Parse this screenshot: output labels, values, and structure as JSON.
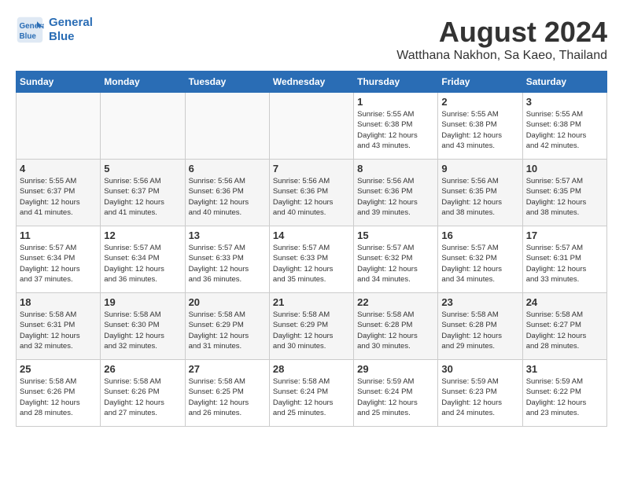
{
  "logo": {
    "line1": "General",
    "line2": "Blue"
  },
  "title": "August 2024",
  "location": "Watthana Nakhon, Sa Kaeo, Thailand",
  "weekdays": [
    "Sunday",
    "Monday",
    "Tuesday",
    "Wednesday",
    "Thursday",
    "Friday",
    "Saturday"
  ],
  "weeks": [
    [
      {
        "day": "",
        "info": ""
      },
      {
        "day": "",
        "info": ""
      },
      {
        "day": "",
        "info": ""
      },
      {
        "day": "",
        "info": ""
      },
      {
        "day": "1",
        "info": "Sunrise: 5:55 AM\nSunset: 6:38 PM\nDaylight: 12 hours\nand 43 minutes."
      },
      {
        "day": "2",
        "info": "Sunrise: 5:55 AM\nSunset: 6:38 PM\nDaylight: 12 hours\nand 43 minutes."
      },
      {
        "day": "3",
        "info": "Sunrise: 5:55 AM\nSunset: 6:38 PM\nDaylight: 12 hours\nand 42 minutes."
      }
    ],
    [
      {
        "day": "4",
        "info": "Sunrise: 5:55 AM\nSunset: 6:37 PM\nDaylight: 12 hours\nand 41 minutes."
      },
      {
        "day": "5",
        "info": "Sunrise: 5:56 AM\nSunset: 6:37 PM\nDaylight: 12 hours\nand 41 minutes."
      },
      {
        "day": "6",
        "info": "Sunrise: 5:56 AM\nSunset: 6:36 PM\nDaylight: 12 hours\nand 40 minutes."
      },
      {
        "day": "7",
        "info": "Sunrise: 5:56 AM\nSunset: 6:36 PM\nDaylight: 12 hours\nand 40 minutes."
      },
      {
        "day": "8",
        "info": "Sunrise: 5:56 AM\nSunset: 6:36 PM\nDaylight: 12 hours\nand 39 minutes."
      },
      {
        "day": "9",
        "info": "Sunrise: 5:56 AM\nSunset: 6:35 PM\nDaylight: 12 hours\nand 38 minutes."
      },
      {
        "day": "10",
        "info": "Sunrise: 5:57 AM\nSunset: 6:35 PM\nDaylight: 12 hours\nand 38 minutes."
      }
    ],
    [
      {
        "day": "11",
        "info": "Sunrise: 5:57 AM\nSunset: 6:34 PM\nDaylight: 12 hours\nand 37 minutes."
      },
      {
        "day": "12",
        "info": "Sunrise: 5:57 AM\nSunset: 6:34 PM\nDaylight: 12 hours\nand 36 minutes."
      },
      {
        "day": "13",
        "info": "Sunrise: 5:57 AM\nSunset: 6:33 PM\nDaylight: 12 hours\nand 36 minutes."
      },
      {
        "day": "14",
        "info": "Sunrise: 5:57 AM\nSunset: 6:33 PM\nDaylight: 12 hours\nand 35 minutes."
      },
      {
        "day": "15",
        "info": "Sunrise: 5:57 AM\nSunset: 6:32 PM\nDaylight: 12 hours\nand 34 minutes."
      },
      {
        "day": "16",
        "info": "Sunrise: 5:57 AM\nSunset: 6:32 PM\nDaylight: 12 hours\nand 34 minutes."
      },
      {
        "day": "17",
        "info": "Sunrise: 5:57 AM\nSunset: 6:31 PM\nDaylight: 12 hours\nand 33 minutes."
      }
    ],
    [
      {
        "day": "18",
        "info": "Sunrise: 5:58 AM\nSunset: 6:31 PM\nDaylight: 12 hours\nand 32 minutes."
      },
      {
        "day": "19",
        "info": "Sunrise: 5:58 AM\nSunset: 6:30 PM\nDaylight: 12 hours\nand 32 minutes."
      },
      {
        "day": "20",
        "info": "Sunrise: 5:58 AM\nSunset: 6:29 PM\nDaylight: 12 hours\nand 31 minutes."
      },
      {
        "day": "21",
        "info": "Sunrise: 5:58 AM\nSunset: 6:29 PM\nDaylight: 12 hours\nand 30 minutes."
      },
      {
        "day": "22",
        "info": "Sunrise: 5:58 AM\nSunset: 6:28 PM\nDaylight: 12 hours\nand 30 minutes."
      },
      {
        "day": "23",
        "info": "Sunrise: 5:58 AM\nSunset: 6:28 PM\nDaylight: 12 hours\nand 29 minutes."
      },
      {
        "day": "24",
        "info": "Sunrise: 5:58 AM\nSunset: 6:27 PM\nDaylight: 12 hours\nand 28 minutes."
      }
    ],
    [
      {
        "day": "25",
        "info": "Sunrise: 5:58 AM\nSunset: 6:26 PM\nDaylight: 12 hours\nand 28 minutes."
      },
      {
        "day": "26",
        "info": "Sunrise: 5:58 AM\nSunset: 6:26 PM\nDaylight: 12 hours\nand 27 minutes."
      },
      {
        "day": "27",
        "info": "Sunrise: 5:58 AM\nSunset: 6:25 PM\nDaylight: 12 hours\nand 26 minutes."
      },
      {
        "day": "28",
        "info": "Sunrise: 5:58 AM\nSunset: 6:24 PM\nDaylight: 12 hours\nand 25 minutes."
      },
      {
        "day": "29",
        "info": "Sunrise: 5:59 AM\nSunset: 6:24 PM\nDaylight: 12 hours\nand 25 minutes."
      },
      {
        "day": "30",
        "info": "Sunrise: 5:59 AM\nSunset: 6:23 PM\nDaylight: 12 hours\nand 24 minutes."
      },
      {
        "day": "31",
        "info": "Sunrise: 5:59 AM\nSunset: 6:22 PM\nDaylight: 12 hours\nand 23 minutes."
      }
    ]
  ]
}
